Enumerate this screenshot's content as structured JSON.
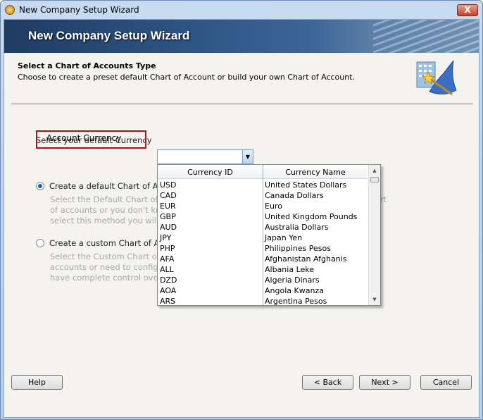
{
  "window": {
    "title": "New Company Setup Wizard",
    "close_label": "X"
  },
  "banner": {
    "title": "New Company Setup Wizard"
  },
  "header": {
    "heading": "Select a Chart of Accounts Type",
    "subtitle": "Choose to create a preset default Chart of Account or build your own Chart of Account."
  },
  "currency": {
    "prompt": "Select your default Currency",
    "field_label": "Account Currency",
    "value": "",
    "columns": [
      "Currency ID",
      "Currency Name"
    ],
    "rows": [
      [
        "USD",
        "United States Dollars"
      ],
      [
        "CAD",
        "Canada Dollars"
      ],
      [
        "EUR",
        "Euro"
      ],
      [
        "GBP",
        "United Kingdom Pounds"
      ],
      [
        "AUD",
        "Australia Dollars"
      ],
      [
        "JPY",
        "Japan Yen"
      ],
      [
        "PHP",
        "Philippines Pesos"
      ],
      [
        "AFA",
        "Afghanistan Afghanis"
      ],
      [
        "ALL",
        "Albania Leke"
      ],
      [
        "DZD",
        "Algeria Dinars"
      ],
      [
        "AOA",
        "Angola Kwanza"
      ],
      [
        "ARS",
        "Argentina Pesos"
      ]
    ]
  },
  "options": [
    {
      "label": "Create a default Chart of Accou",
      "selected": true,
      "desc": [
        "Select the Default Chart of Ac",
        "of accounts or you don't kno",
        "select this method you will st"
      ],
      "desc_tail": "rt"
    },
    {
      "label": "Create a custom Chart of Accou",
      "selected": false,
      "desc": [
        "Select the Custom Chart of A",
        "accounts or need to configur",
        "have complete control over h"
      ]
    }
  ],
  "buttons": {
    "help": "Help",
    "back": "< Back",
    "next": "Next >",
    "cancel": "Cancel"
  }
}
